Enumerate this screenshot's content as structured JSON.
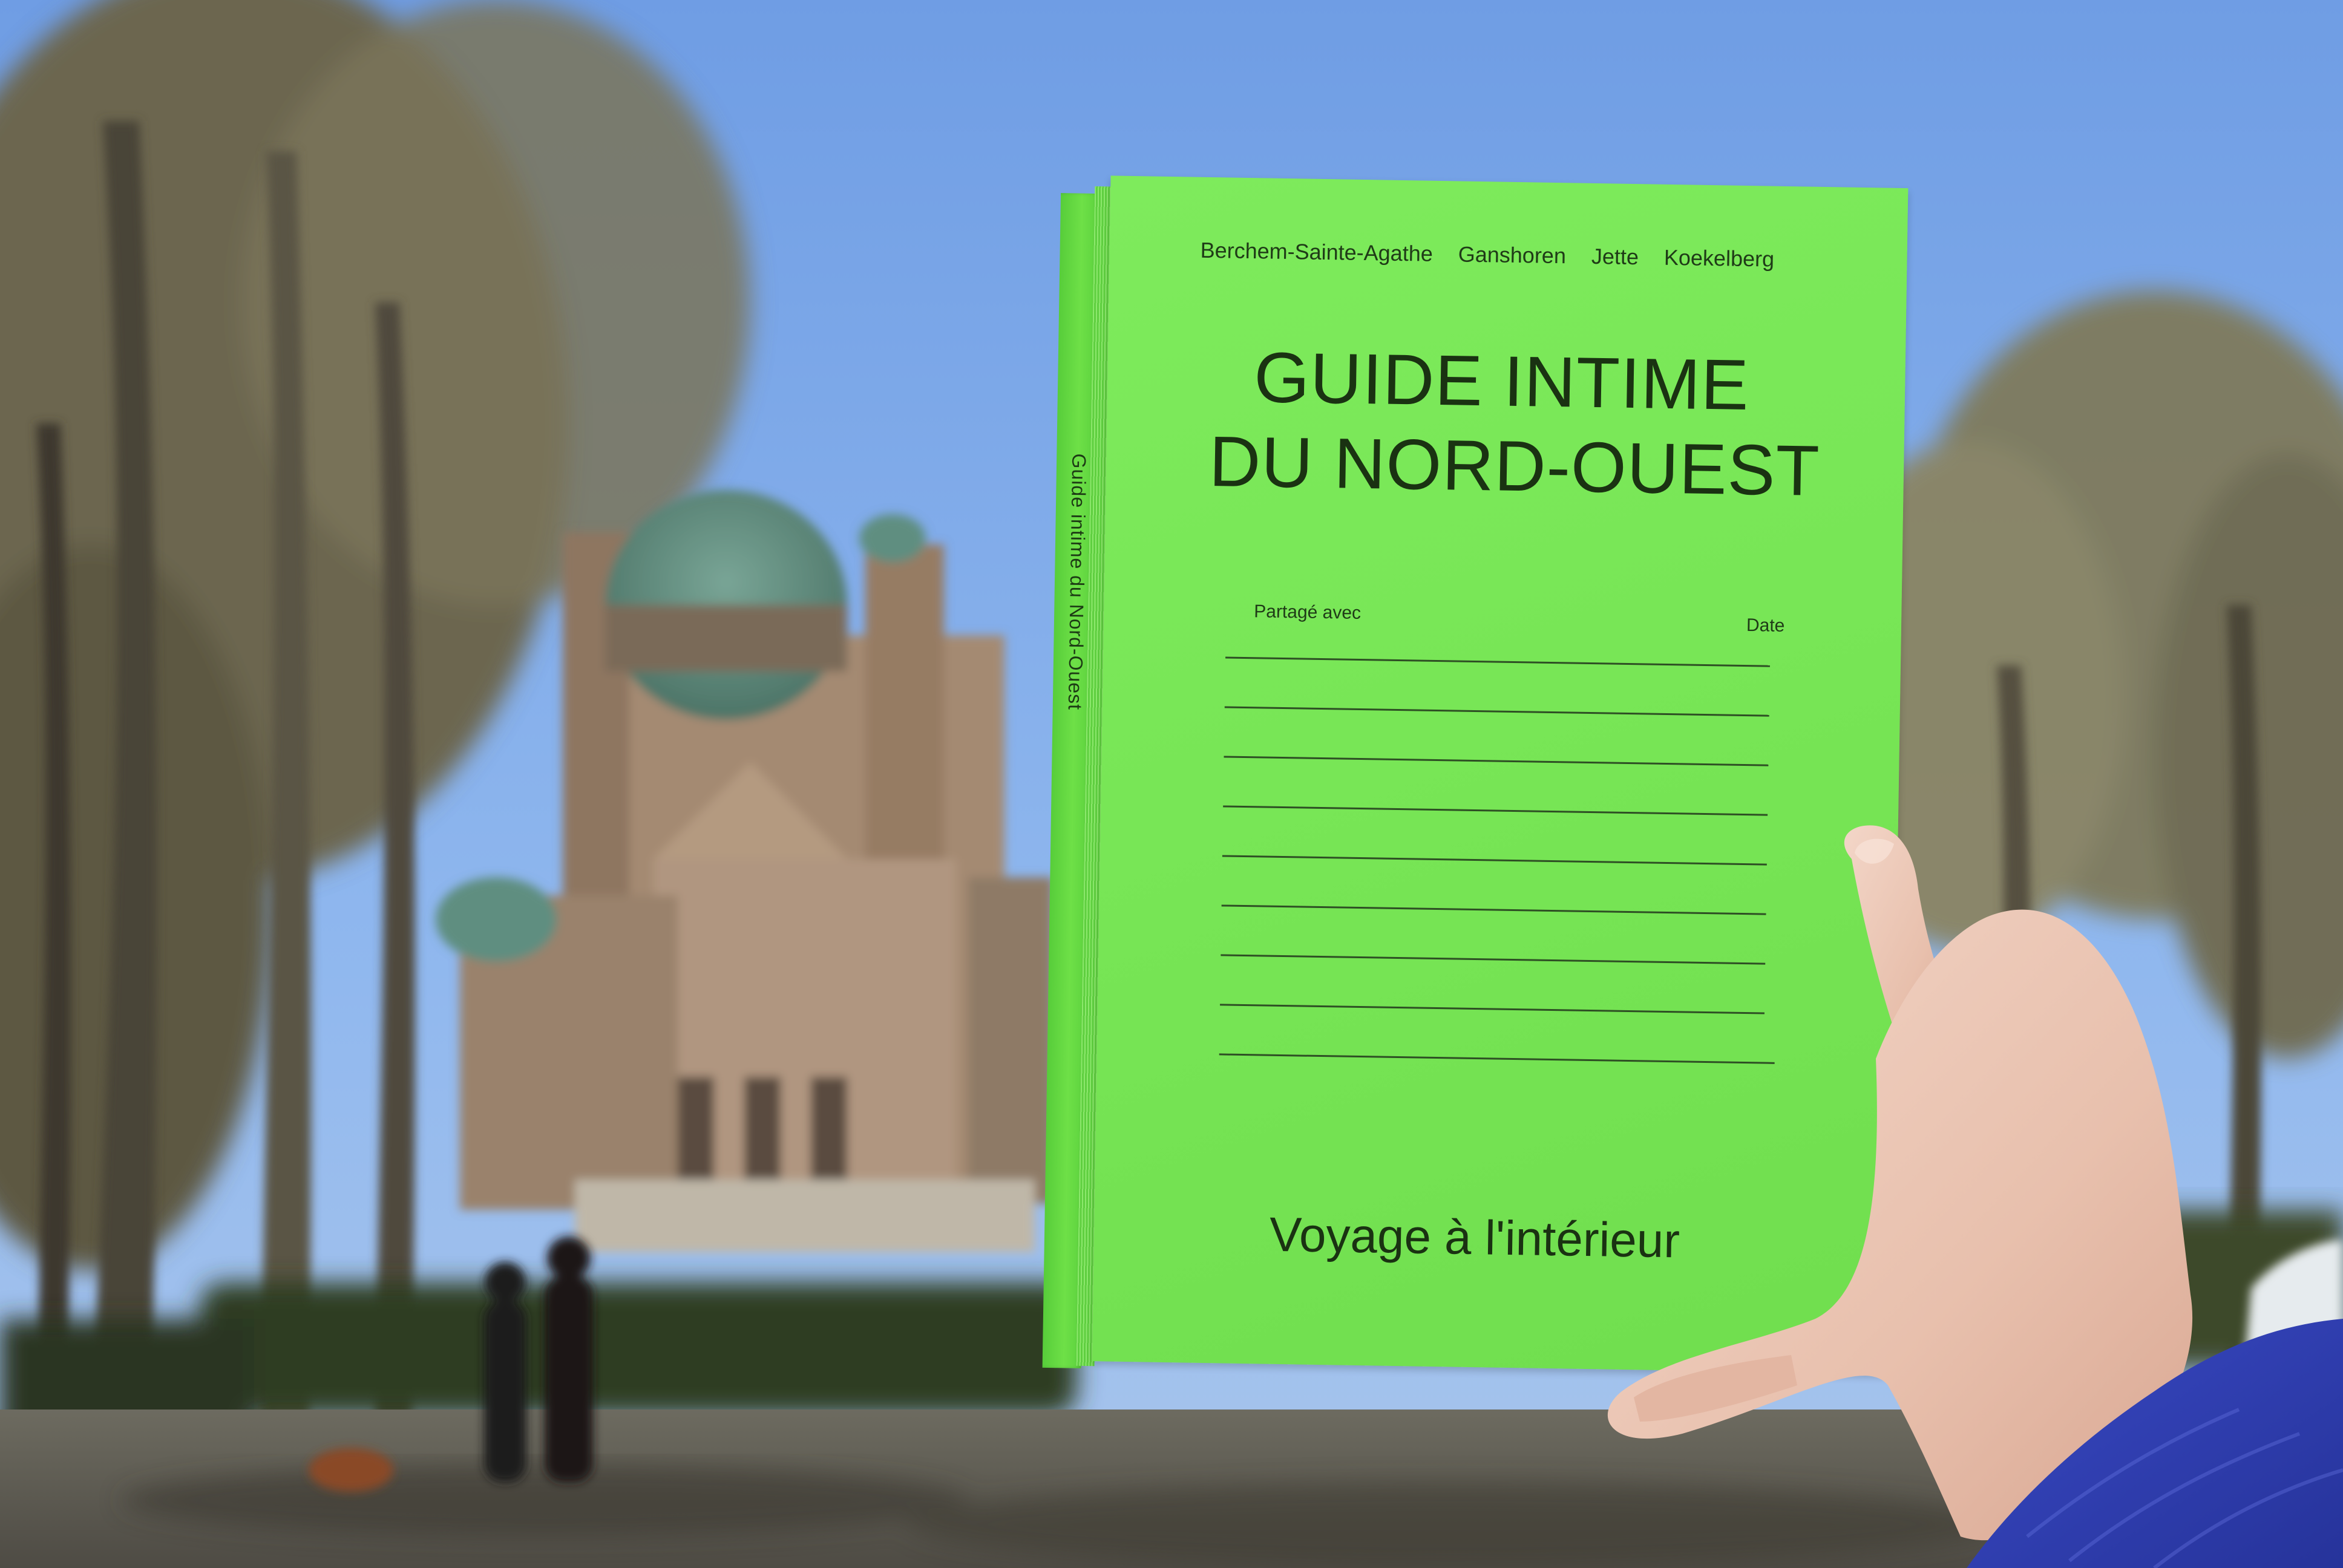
{
  "book": {
    "spine_title": "Guide intime du Nord-Ouest",
    "communes": [
      "Berchem-Sainte-Agathe",
      "Ganshoren",
      "Jette",
      "Koekelberg"
    ],
    "title_line1": "GUIDE INTIME",
    "title_line2": "DU NORD-OUEST",
    "label_shared": "Partagé avec",
    "label_date": "Date",
    "subtitle": "Voyage à l'intérieur",
    "cover_color": "#78e656",
    "ink_color": "#1a3212"
  },
  "scene": {
    "sky_color": "#7aa9ea",
    "basilica_color": "#a48a72",
    "dome_color": "#5f8e80",
    "sleeve_color": "#2f3fb6"
  }
}
